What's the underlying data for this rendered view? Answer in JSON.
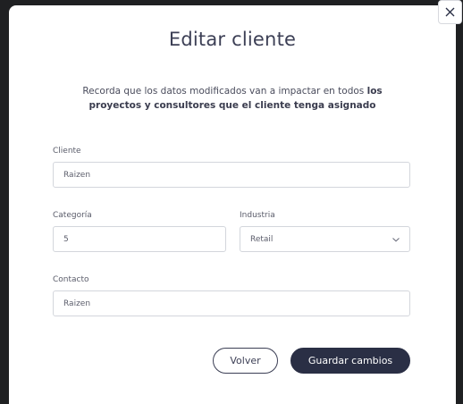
{
  "modal": {
    "title": "Editar cliente",
    "description_normal": "Recorda que los datos modificados van a impactar en todos ",
    "description_bold": "los proyectos y consultores que el cliente tenga asignado"
  },
  "form": {
    "cliente": {
      "label": "Cliente",
      "value": "Raizen"
    },
    "categoria": {
      "label": "Categoría",
      "value": "5"
    },
    "industria": {
      "label": "Industria",
      "value": "Retail"
    },
    "contacto": {
      "label": "Contacto",
      "value": "Raizen"
    }
  },
  "actions": {
    "back_label": "Volver",
    "save_label": "Guardar cambios"
  },
  "icons": {
    "close": "close-icon",
    "chevron": "chevron-down-icon"
  },
  "colors": {
    "primary": "#2a2f45",
    "title": "#3c3f55",
    "border": "#d3d6dc"
  }
}
